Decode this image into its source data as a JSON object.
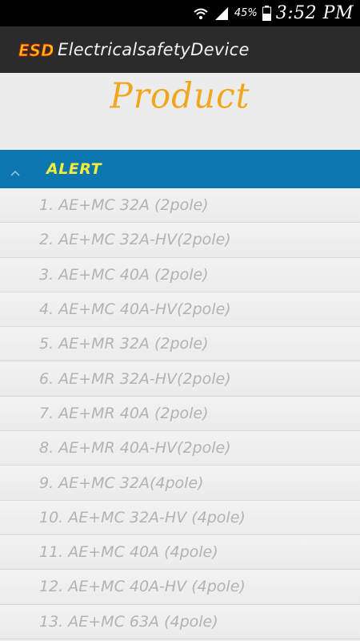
{
  "status_bar": {
    "battery_percent": "45%",
    "time": "3:52 PM",
    "icons": [
      "wifi-icon",
      "signal-icon",
      "battery-icon"
    ]
  },
  "action_bar": {
    "logo_text": "ESD",
    "title": "ElectricalsafetyDevice"
  },
  "header": {
    "title": "Product"
  },
  "group": {
    "label": "ALERT",
    "icon": "chevron-up-icon",
    "expanded": true
  },
  "products": [
    {
      "label": "1.  AE+MC 32A (2pole)"
    },
    {
      "label": "2.  AE+MC 32A-HV(2pole)"
    },
    {
      "label": "3.  AE+MC 40A (2pole)"
    },
    {
      "label": "4.  AE+MC 40A-HV(2pole)"
    },
    {
      "label": "5.  AE+MR 32A (2pole)"
    },
    {
      "label": "6.  AE+MR 32A-HV(2pole)"
    },
    {
      "label": "7.  AE+MR 40A (2pole)"
    },
    {
      "label": "8.  AE+MR 40A-HV(2pole)"
    },
    {
      "label": "9.  AE+MC 32A(4pole)"
    },
    {
      "label": "10. AE+MC 32A-HV (4pole)"
    },
    {
      "label": "11. AE+MC 40A (4pole)"
    },
    {
      "label": "12. AE+MC 40A-HV (4pole)"
    },
    {
      "label": "13. AE+MC 63A (4pole)"
    }
  ],
  "colors": {
    "action_bar": "#2b2b2b",
    "accent_title": "#efa81e",
    "group_header": "#0c76b1",
    "group_label": "#f4ec3b",
    "item_text": "#b3b3b3"
  }
}
